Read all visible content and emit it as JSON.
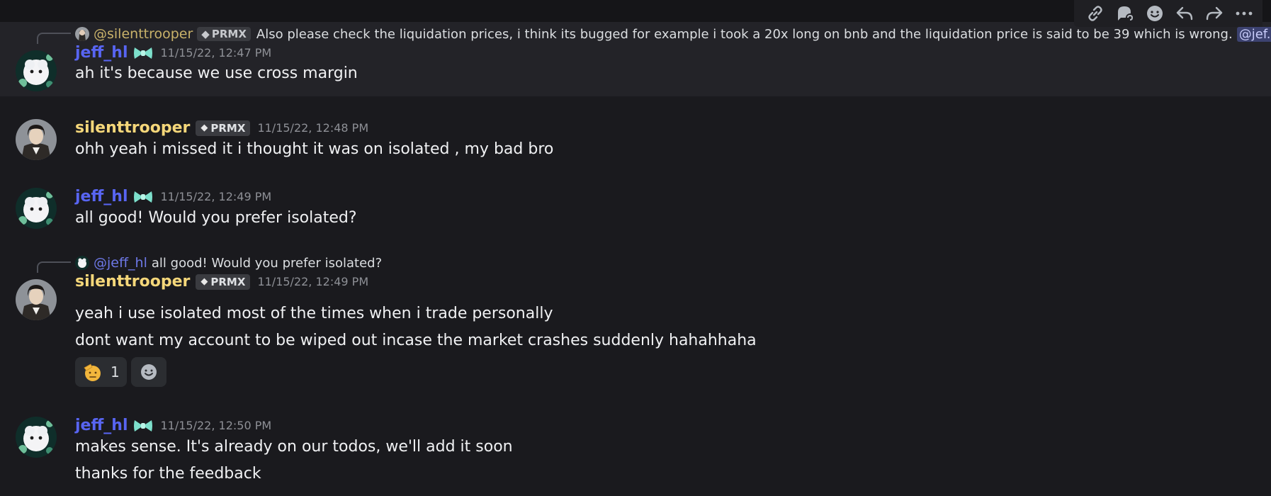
{
  "toolbar": {
    "icons": [
      "link-icon",
      "thread-icon",
      "add-reaction-icon",
      "reply-icon",
      "forward-icon",
      "more-icon"
    ]
  },
  "messages": [
    {
      "reply": {
        "author": "@silenttrooper",
        "badge": "PRMX",
        "text": "Also please check the liquidation prices, i think its bugged for example i took a 20x long on bnb and the liquidation price is said to be 39 which is wrong.",
        "mention": "@jef..."
      },
      "author": "jeff_hl",
      "time": "11/15/22, 12:47 PM",
      "lines": [
        "ah it's because we use cross margin"
      ]
    },
    {
      "author": "silenttrooper",
      "badge": "PRMX",
      "time": "11/15/22, 12:48 PM",
      "lines": [
        "ohh yeah i missed it i thought it was on isolated , my bad bro"
      ]
    },
    {
      "author": "jeff_hl",
      "time": "11/15/22, 12:49 PM",
      "lines": [
        "all good! Would you prefer isolated?"
      ]
    },
    {
      "reply": {
        "author": "@jeff_hl",
        "text": "all good! Would you prefer isolated?"
      },
      "author": "silenttrooper",
      "badge": "PRMX",
      "time": "11/15/22, 12:49 PM",
      "lines": [
        "yeah i use isolated most of the times when i trade personally",
        "dont want my account to be wiped out incase the market crashes suddenly hahahhaha"
      ],
      "reactions": [
        {
          "emoji": "saluting-face",
          "count": "1"
        }
      ]
    },
    {
      "author": "jeff_hl",
      "time": "11/15/22, 12:50 PM",
      "lines": [
        "makes sense. It's already on our todos, we'll add it soon",
        "thanks for the feedback"
      ]
    }
  ],
  "colors": {
    "background": "#1a1a1e",
    "jeff_name": "#5865f2",
    "silent_name": "#f5d77a",
    "timestamp": "#8e9096"
  }
}
